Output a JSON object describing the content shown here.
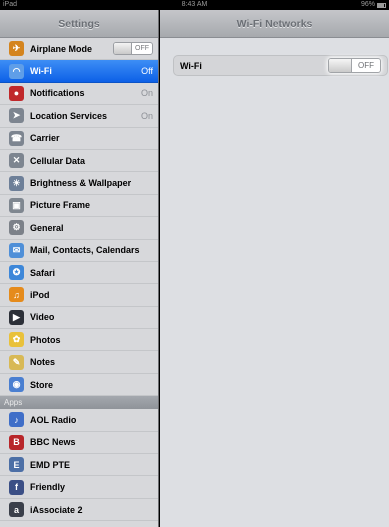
{
  "status_bar": {
    "device": "iPad",
    "time": "8:43 AM",
    "battery": "96%"
  },
  "left_pane": {
    "title": "Settings",
    "rows": [
      {
        "label": "Airplane Mode",
        "icon": "airplane-icon",
        "icon_color": "#d4841e",
        "switch": "OFF"
      },
      {
        "label": "Wi-Fi",
        "icon": "wifi-icon",
        "icon_color": "#5f9ee8",
        "value": "Off",
        "selected": true
      },
      {
        "label": "Notifications",
        "icon": "notifications-icon",
        "icon_color": "#c0282b",
        "value": "On"
      },
      {
        "label": "Location Services",
        "icon": "location-icon",
        "icon_color": "#7d8590",
        "value": "On"
      },
      {
        "label": "Carrier",
        "icon": "carrier-icon",
        "icon_color": "#7d8590"
      },
      {
        "label": "Cellular Data",
        "icon": "cellular-icon",
        "icon_color": "#7d8590"
      },
      {
        "label": "Brightness & Wallpaper",
        "icon": "brightness-icon",
        "icon_color": "#6d7f98"
      },
      {
        "label": "Picture Frame",
        "icon": "picture-frame-icon",
        "icon_color": "#7f8790"
      },
      {
        "label": "General",
        "icon": "gear-icon",
        "icon_color": "#7c8189"
      },
      {
        "label": "Mail, Contacts, Calendars",
        "icon": "mail-icon",
        "icon_color": "#4f8fd8"
      },
      {
        "label": "Safari",
        "icon": "safari-icon",
        "icon_color": "#3d87d9"
      },
      {
        "label": "iPod",
        "icon": "ipod-icon",
        "icon_color": "#e58b1c"
      },
      {
        "label": "Video",
        "icon": "video-icon",
        "icon_color": "#2c3038"
      },
      {
        "label": "Photos",
        "icon": "photos-icon",
        "icon_color": "#e9c13a"
      },
      {
        "label": "Notes",
        "icon": "notes-icon",
        "icon_color": "#d8b955"
      },
      {
        "label": "Store",
        "icon": "store-icon",
        "icon_color": "#4a7fd1"
      }
    ],
    "apps_header": "Apps",
    "apps": [
      {
        "label": "AOL Radio",
        "icon": "aol-radio-icon",
        "icon_color": "#3f6ec8"
      },
      {
        "label": "BBC News",
        "icon": "bbc-news-icon",
        "icon_color": "#b8262a"
      },
      {
        "label": "EMD PTE",
        "icon": "emd-pte-icon",
        "icon_color": "#4c6fa6"
      },
      {
        "label": "Friendly",
        "icon": "friendly-icon",
        "icon_color": "#3b4f86"
      },
      {
        "label": "iAssociate 2",
        "icon": "iassociate-icon",
        "icon_color": "#3a3f4a"
      }
    ]
  },
  "right_pane": {
    "title": "Wi-Fi Networks",
    "wifi_label": "Wi-Fi",
    "wifi_switch": "OFF"
  }
}
